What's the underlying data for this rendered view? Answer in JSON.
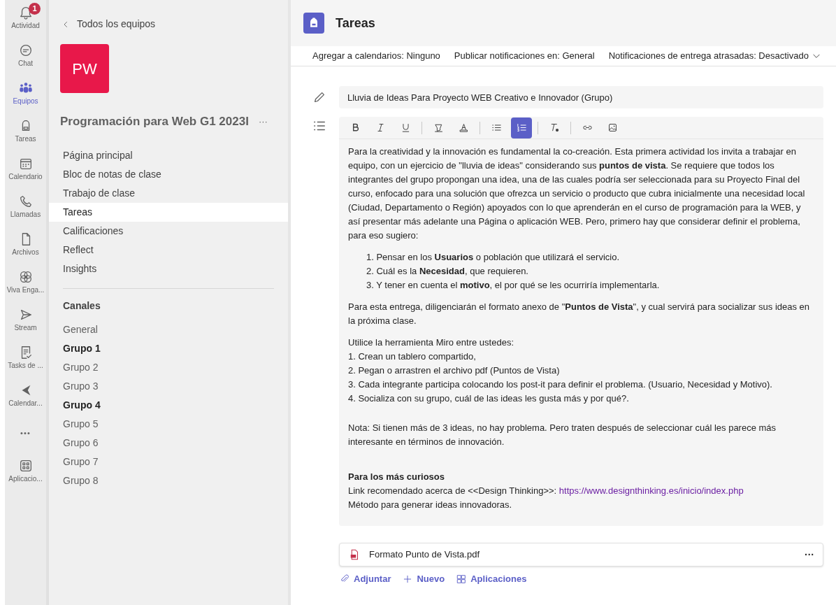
{
  "app_bar": [
    {
      "kind": "bell",
      "label": "Actividad",
      "selected": false,
      "badge": "1"
    },
    {
      "kind": "chat",
      "label": "Chat",
      "selected": false
    },
    {
      "kind": "teams",
      "label": "Equipos",
      "selected": true
    },
    {
      "kind": "backpack",
      "label": "Tareas",
      "selected": false
    },
    {
      "kind": "calendar",
      "label": "Calendario",
      "selected": false
    },
    {
      "kind": "phone",
      "label": "Llamadas",
      "selected": false
    },
    {
      "kind": "file",
      "label": "Archivos",
      "selected": false
    },
    {
      "kind": "viva",
      "label": "Viva Enga...",
      "selected": false
    },
    {
      "kind": "stream",
      "label": "Stream",
      "selected": false
    },
    {
      "kind": "tasks",
      "label": "Tasks de ...",
      "selected": false
    },
    {
      "kind": "chevron",
      "label": "Calendar...",
      "selected": false
    },
    {
      "kind": "more",
      "label": "•••",
      "selected": false
    },
    {
      "kind": "apps",
      "label": "Aplicacio...",
      "selected": false
    }
  ],
  "team": {
    "back": "Todos los equipos",
    "avatar": "PW",
    "name": "Programación para Web G1 2023I",
    "more": "···",
    "nav": [
      {
        "label": "Página principal",
        "selected": false
      },
      {
        "label": "Bloc de notas de clase",
        "selected": false
      },
      {
        "label": "Trabajo de clase",
        "selected": false
      },
      {
        "label": "Tareas",
        "selected": true
      },
      {
        "label": "Calificaciones",
        "selected": false
      },
      {
        "label": "Reflect",
        "selected": false
      },
      {
        "label": "Insights",
        "selected": false
      }
    ],
    "channels_title": "Canales",
    "channels": [
      {
        "label": "General",
        "unread": false
      },
      {
        "label": "Grupo 1",
        "unread": true
      },
      {
        "label": "Grupo 2",
        "unread": false
      },
      {
        "label": "Grupo 3",
        "unread": false
      },
      {
        "label": "Grupo 4",
        "unread": true
      },
      {
        "label": "Grupo 5",
        "unread": false
      },
      {
        "label": "Grupo 6",
        "unread": false
      },
      {
        "label": "Grupo 7",
        "unread": false
      },
      {
        "label": "Grupo 8",
        "unread": false
      }
    ]
  },
  "header": {
    "title": "Tareas"
  },
  "settings": [
    "Agregar a calendarios: Ninguno",
    "Publicar notificaciones en: General",
    "Notificaciones de entrega atrasadas: Desactivado"
  ],
  "assignment": {
    "title": "Lluvia de Ideas Para Proyecto WEB Creativo e Innovador (Grupo)",
    "toolbar": [
      {
        "kind": "bold",
        "selected": false
      },
      {
        "kind": "italic",
        "selected": false
      },
      {
        "kind": "underline",
        "selected": false
      },
      {
        "kind": "sep"
      },
      {
        "kind": "highlight",
        "selected": false
      },
      {
        "kind": "fontcolor",
        "selected": false
      },
      {
        "kind": "sep"
      },
      {
        "kind": "bullets",
        "selected": false
      },
      {
        "kind": "numbers",
        "selected": true
      },
      {
        "kind": "sep"
      },
      {
        "kind": "clear",
        "selected": false
      },
      {
        "kind": "sep"
      },
      {
        "kind": "link",
        "selected": false
      },
      {
        "kind": "image",
        "selected": false
      }
    ],
    "body": [
      {
        "kind": "p",
        "text": "Para la creatividad y la innovación es fundamental la co-creación. Esta primera actividad los invita a trabajar en equipo, con un ejercicio de \"lluvia de ideas\" considerando sus **puntos de vista**. Se requiere que todos los integrantes del grupo propongan una idea, una de las cuales podría ser seleccionada para su Proyecto Final del curso, enfocado para una solución que ofrezca un servicio o producto que cubra inicialmente una necesidad local (Ciudad, Departamento o Región) apoyados con lo que aprenderán en el curso de programación para la WEB, y así presentar más adelante una Página o aplicación WEB. Pero, primero hay que considerar definir el problema, para eso sugiero:"
      },
      {
        "kind": "ol",
        "items": [
          "1. Pensar en los **Usuarios** o población que utilizará el servicio.",
          "2. Cuál es la **Necesidad**, que requieren.",
          "3. Y tener en cuenta el **motivo**, el por qué se les ocurriría implementarla."
        ]
      },
      {
        "kind": "p",
        "text": "Para esta entrega, diligenciarán el formato anexo de \"**Puntos de Vista**\", y cual servirá para socializar sus ideas en la próxima clase."
      },
      {
        "kind": "line",
        "text": "Utilice la herramienta Miro entre ustedes:"
      },
      {
        "kind": "line",
        "text": "1. Crean un tablero compartido,"
      },
      {
        "kind": "line",
        "text": "2. Pegan o arrastren el archivo pdf (Puntos de Vista)"
      },
      {
        "kind": "line",
        "text": "3. Cada integrante participa colocando los post-it para definir el problema. (Usuario, Necesidad y Motivo)."
      },
      {
        "kind": "line",
        "text": "4. Socializa con su grupo, cuál de las ideas les gusta más y por qué?."
      },
      {
        "kind": "p",
        "text": "Nota: Si tienen más de 3 ideas, no hay problema. Pero traten después de seleccionar cuál les parece más interesante en términos de innovación."
      },
      {
        "kind": "heading",
        "text": "Para los más curiosos"
      },
      {
        "kind": "link",
        "text": "Link recomendado acerca de <<Design Thinking>>: ",
        "url": "https://www.designthinking.es/inicio/index.php"
      },
      {
        "kind": "line",
        "text": "Método para generar ideas innovadoras."
      }
    ],
    "attachment": {
      "name": "Formato Punto de Vista.pdf",
      "more": "···"
    },
    "actions": [
      {
        "kind": "clip",
        "label": "Adjuntar"
      },
      {
        "kind": "plus",
        "label": "Nuevo"
      },
      {
        "kind": "apps",
        "label": "Aplicaciones"
      }
    ]
  }
}
